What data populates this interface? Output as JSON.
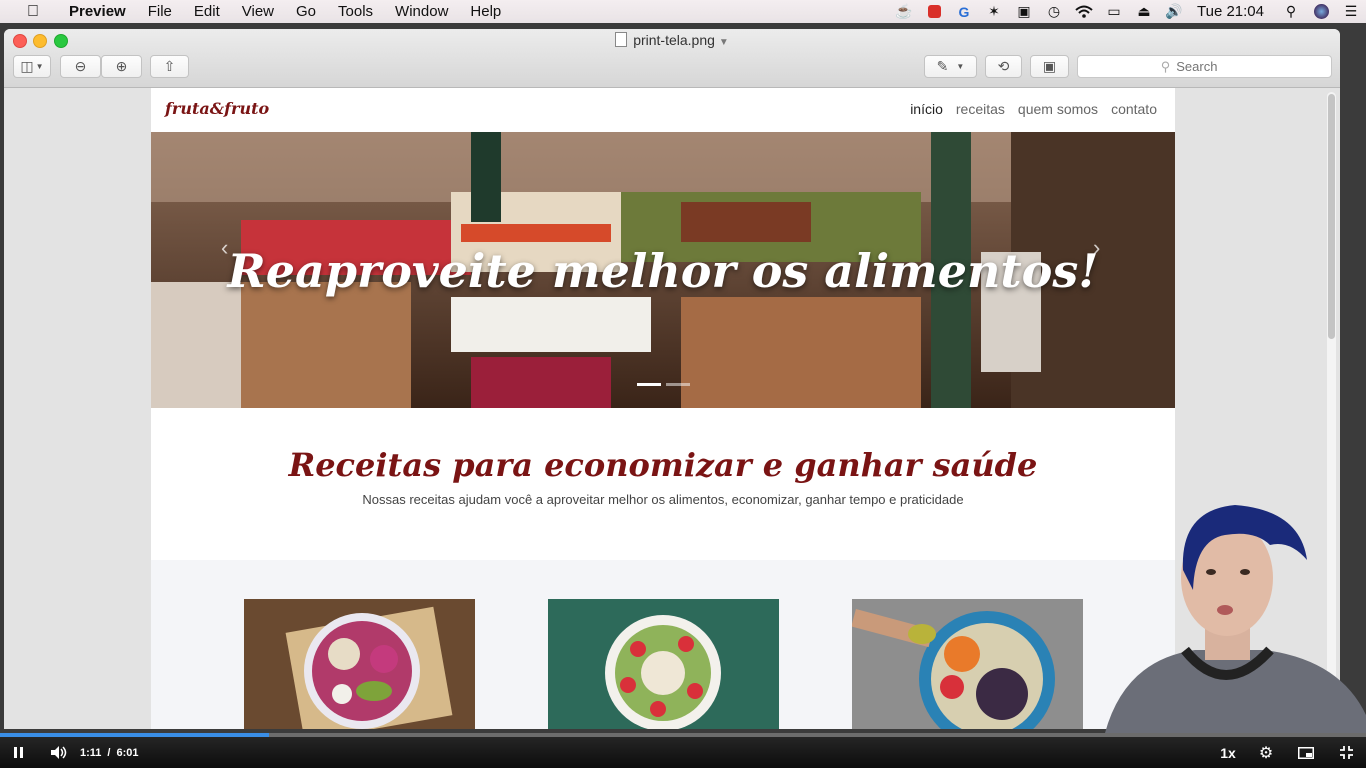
{
  "menubar": {
    "apple_icon": "apple-icon",
    "app_name": "Preview",
    "menus": [
      "File",
      "Edit",
      "View",
      "Go",
      "Tools",
      "Window",
      "Help"
    ],
    "tray_icons": [
      "coffee-cup-icon",
      "red-app-icon",
      "grammarly-icon",
      "bluetooth-icon",
      "screen-record-icon",
      "time-machine-icon",
      "wifi-icon",
      "airplay-icon",
      "eject-icon",
      "volume-icon"
    ],
    "clock": "Tue 21:04",
    "right_icons": [
      "spotlight-icon",
      "siri-icon",
      "notification-center-icon"
    ]
  },
  "window": {
    "title": "print-tela.png",
    "toolbar": {
      "search_placeholder": "Search"
    }
  },
  "website": {
    "logo": "fruta&fruto",
    "nav": [
      {
        "label": "início",
        "active": true
      },
      {
        "label": "receitas",
        "active": false
      },
      {
        "label": "quem somos",
        "active": false
      },
      {
        "label": "contato",
        "active": false
      }
    ],
    "hero_caption": "Reaproveite melhor os alimentos!",
    "carousel_prev": "‹",
    "carousel_next": "›",
    "carousel_slides": 2,
    "carousel_active": 1,
    "section_title": "Receitas para economizar e ganhar saúde",
    "section_subtitle": "Nossas receitas ajudam você a aproveitar melhor os alimentos, economizar, ganhar tempo e praticidade",
    "colors": {
      "brand": "#7a1414"
    }
  },
  "player": {
    "time_current": "1:11",
    "time_separator": "/",
    "time_total": "6:01",
    "speed": "1x",
    "progress": 0.197,
    "icons": [
      "pause-icon",
      "volume-icon",
      "settings-icon",
      "picture-in-picture-icon",
      "exit-fullscreen-icon"
    ],
    "colors": {
      "progress": "#3a8ee6"
    }
  }
}
